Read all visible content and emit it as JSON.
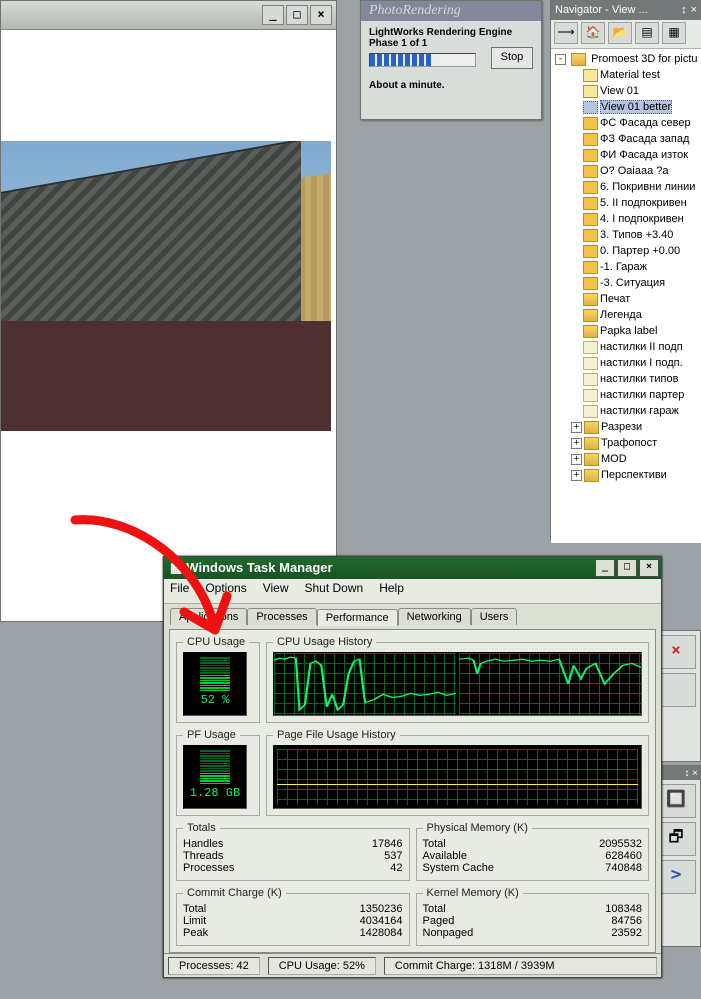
{
  "render_window": {
    "btn_min": "_",
    "btn_max": "□",
    "btn_close": "×"
  },
  "photo_dialog": {
    "title": "PhotoRendering",
    "line1": "LightWorks Rendering Engine",
    "line2": "Phase 1 of 1",
    "eta": "About a minute.",
    "stop": "Stop"
  },
  "navigator": {
    "title": "Navigator - View ...",
    "pin": "↕",
    "close": "×",
    "toolbar": [
      "⟶",
      "🏠",
      "📂",
      "▤",
      "▦"
    ],
    "root": "Promoest 3D for pictu",
    "items": [
      {
        "label": "Material test",
        "ico": "cam"
      },
      {
        "label": "View 01",
        "ico": "cam"
      },
      {
        "label": "View 01 better",
        "ico": "cam",
        "sel": true
      },
      {
        "label": "ФС Фасада север",
        "ico": "view"
      },
      {
        "label": "ФЗ Фасада запад",
        "ico": "view"
      },
      {
        "label": "ФИ Фасада изток",
        "ico": "view"
      },
      {
        "label": "О? Oaiaaa ?a",
        "ico": "view"
      },
      {
        "label": "6. Покривни линии",
        "ico": "view"
      },
      {
        "label": "5. II подпокривен",
        "ico": "view"
      },
      {
        "label": "4. I подпокривен",
        "ico": "view"
      },
      {
        "label": "3. Типов +3.40",
        "ico": "view"
      },
      {
        "label": "0. Партер +0.00",
        "ico": "view"
      },
      {
        "label": "-1. Гараж",
        "ico": "view"
      },
      {
        "label": "-3. Ситуация",
        "ico": "view"
      },
      {
        "label": "Печат",
        "ico": "folder"
      },
      {
        "label": "Легенда",
        "ico": "folder"
      },
      {
        "label": "Papka label",
        "ico": "folder"
      },
      {
        "label": "настилки II подп",
        "ico": "file"
      },
      {
        "label": "настилки I подп.",
        "ico": "file"
      },
      {
        "label": "настилки типов",
        "ico": "file"
      },
      {
        "label": "настилки партер",
        "ico": "file"
      },
      {
        "label": "настилки гараж",
        "ico": "file"
      }
    ],
    "items2": [
      {
        "label": "Разрези"
      },
      {
        "label": "Трафопост"
      },
      {
        "label": "MOD"
      },
      {
        "label": "Перспективи"
      }
    ]
  },
  "right_tools": {
    "close": "×",
    "arrow": ">"
  },
  "taskmgr": {
    "title": "Windows Task Manager",
    "menu": [
      "File",
      "Options",
      "View",
      "Shut Down",
      "Help"
    ],
    "tabs": [
      "Applications",
      "Processes",
      "Performance",
      "Networking",
      "Users"
    ],
    "active_tab_index": 2,
    "cpu_usage_label": "CPU Usage",
    "cpu_usage_value": "52 %",
    "cpu_history_label": "CPU Usage History",
    "pf_usage_label": "PF Usage",
    "pf_usage_value": "1.28 GB",
    "pf_history_label": "Page File Usage History",
    "totals": {
      "legend": "Totals",
      "handles_l": "Handles",
      "handles": "17846",
      "threads_l": "Threads",
      "threads": "537",
      "procs_l": "Processes",
      "procs": "42"
    },
    "phys": {
      "legend": "Physical Memory (K)",
      "total_l": "Total",
      "total": "2095532",
      "avail_l": "Available",
      "avail": "628460",
      "cache_l": "System Cache",
      "cache": "740848"
    },
    "commit": {
      "legend": "Commit Charge (K)",
      "total_l": "Total",
      "total": "1350236",
      "limit_l": "Limit",
      "limit": "4034164",
      "peak_l": "Peak",
      "peak": "1428084"
    },
    "kernel": {
      "legend": "Kernel Memory (K)",
      "total_l": "Total",
      "total": "108348",
      "paged_l": "Paged",
      "paged": "84756",
      "nonp_l": "Nonpaged",
      "nonp": "23592"
    },
    "status": {
      "procs": "Processes: 42",
      "cpu": "CPU Usage: 52%",
      "commit": "Commit Charge: 1318M / 3939M"
    },
    "win_btns": {
      "min": "_",
      "max": "□",
      "close": "×"
    }
  }
}
